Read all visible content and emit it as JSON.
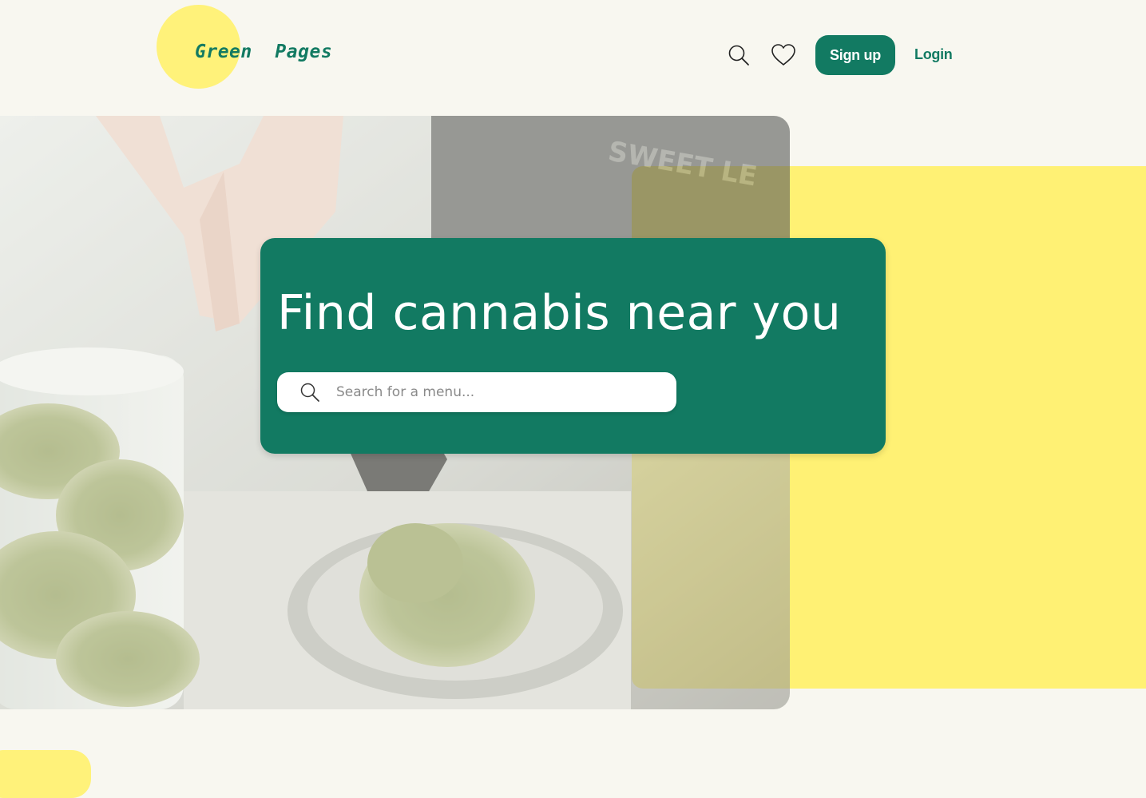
{
  "header": {
    "logo_text": "Green  Pages",
    "signup_label": "Sign up",
    "login_label": "Login"
  },
  "hero": {
    "title": "Find cannabis near you",
    "search": {
      "placeholder": "Search for a menu...",
      "value": ""
    }
  },
  "icons": {
    "nav_search": "search-icon",
    "nav_favorites": "heart-icon",
    "hero_search": "search-icon"
  },
  "colors": {
    "brand_green": "#127a62",
    "accent_yellow": "#fff174",
    "page_background": "#f8f7f0"
  }
}
